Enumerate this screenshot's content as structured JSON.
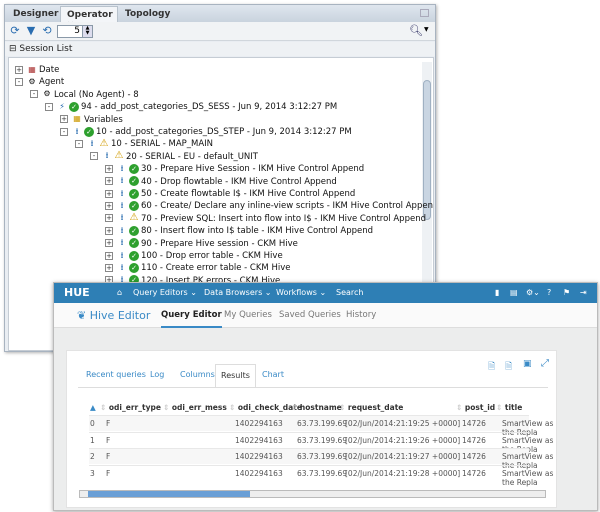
{
  "odi": {
    "tabs": [
      "Designer",
      "Operator",
      "Topology"
    ],
    "tab_close": "×",
    "active_tab": "Operator",
    "toolbar": {
      "spinner_value": "5",
      "icons": [
        "refresh-icon",
        "filter-icon",
        "auto-refresh-icon",
        "search-dropdown-icon"
      ]
    },
    "session_list_label": "Session List",
    "tree": [
      {
        "depth": 0,
        "exp": "+",
        "icon": "date",
        "text": "Date"
      },
      {
        "depth": 0,
        "exp": "-",
        "icon": "gear",
        "text": "Agent"
      },
      {
        "depth": 1,
        "exp": "-",
        "icon": "gear",
        "text": "Local (No Agent) - 8"
      },
      {
        "depth": 2,
        "exp": "-",
        "icon": "session",
        "status": "ok",
        "text": "94 - add_post_categories_DS_SESS - Jun 9, 2014 3:12:27 PM"
      },
      {
        "depth": 3,
        "exp": "+",
        "icon": "variables",
        "text": "Variables"
      },
      {
        "depth": 3,
        "exp": "-",
        "icon": "step",
        "status": "ok",
        "text": "10 - add_post_categories_DS_STEP - Jun 9, 2014 3:12:27 PM"
      },
      {
        "depth": 4,
        "exp": "-",
        "icon": "step",
        "status": "warn",
        "text": "10 - SERIAL - MAP_MAIN"
      },
      {
        "depth": 5,
        "exp": "-",
        "icon": "step",
        "status": "warn",
        "text": "20 - SERIAL - EU - default_UNIT"
      },
      {
        "depth": 6,
        "exp": "+",
        "icon": "step",
        "status": "ok",
        "text": "30 - Prepare Hive Session - IKM Hive Control Append"
      },
      {
        "depth": 6,
        "exp": "+",
        "icon": "step",
        "status": "ok",
        "text": "40 - Drop flowtable - IKM Hive Control Append"
      },
      {
        "depth": 6,
        "exp": "+",
        "icon": "step",
        "status": "ok",
        "text": "50 - Create flowtable I$ - IKM Hive Control Append"
      },
      {
        "depth": 6,
        "exp": "+",
        "icon": "step",
        "status": "ok",
        "text": "60 - Create/ Declare any inline-view scripts - IKM Hive Control Append"
      },
      {
        "depth": 6,
        "exp": "+",
        "icon": "step",
        "status": "warn",
        "text": "70 - Preview SQL: Insert into flow into I$ - IKM Hive Control Append"
      },
      {
        "depth": 6,
        "exp": "+",
        "icon": "step",
        "status": "ok",
        "text": "80 - Insert flow into I$ table - IKM Hive Control Append"
      },
      {
        "depth": 6,
        "exp": "+",
        "icon": "step",
        "status": "ok",
        "text": "90 - Prepare Hive session - CKM Hive"
      },
      {
        "depth": 6,
        "exp": "+",
        "icon": "step",
        "status": "ok",
        "text": "100 - Drop error table - CKM Hive"
      },
      {
        "depth": 6,
        "exp": "+",
        "icon": "step",
        "status": "ok",
        "text": "110 - Create error table - CKM Hive"
      },
      {
        "depth": 6,
        "exp": "+",
        "icon": "step",
        "status": "ok",
        "text": "120 - Insert PK errors - CKM Hive"
      }
    ]
  },
  "hue": {
    "logo": "HUE",
    "nav": [
      "Query Editors ⌄",
      "Data Browsers ⌄",
      "Workflows ⌄",
      "Search"
    ],
    "brand_color": "#2e7fb5",
    "app_title": "Hive Editor",
    "subnav": [
      "Query Editor",
      "My Queries",
      "Saved Queries",
      "History"
    ],
    "active_subnav": "Query Editor",
    "result_tabs": [
      "Recent queries",
      "Log",
      "Columns",
      "Results",
      "Chart"
    ],
    "active_result_tab": "Results",
    "columns": [
      "",
      "odi_err_type",
      "odi_err_mess",
      "odi_check_date",
      "hostname",
      "request_date",
      "post_id",
      "title"
    ],
    "rows": [
      [
        "0",
        "F",
        "",
        "1402294163",
        "63.73.199.69",
        "[02/Jun/2014:21:19:25 +0000]",
        "14726",
        "SmartView as the Repla"
      ],
      [
        "1",
        "F",
        "",
        "1402294163",
        "63.73.199.69",
        "[02/Jun/2014:21:19:26 +0000]",
        "14726",
        "SmartView as the Repla"
      ],
      [
        "2",
        "F",
        "",
        "1402294163",
        "63.73.199.69",
        "[02/Jun/2014:21:19:27 +0000]",
        "14726",
        "SmartView as the Repla"
      ],
      [
        "3",
        "F",
        "",
        "1402294163",
        "63.73.199.69",
        "[02/Jun/2014:21:19:28 +0000]",
        "14726",
        "SmartView as the Repla"
      ]
    ]
  }
}
